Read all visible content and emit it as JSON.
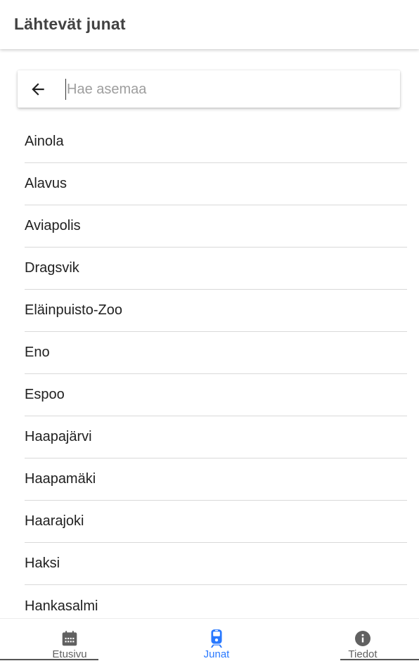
{
  "header": {
    "title": "Lähtevät junat"
  },
  "search": {
    "placeholder": "Hae asemaa",
    "value": ""
  },
  "stations": [
    "Ainola",
    "Alavus",
    "Aviapolis",
    "Dragsvik",
    "Eläinpuisto-Zoo",
    "Eno",
    "Espoo",
    "Haapajärvi",
    "Haapamäki",
    "Haarajoki",
    "Haksi",
    "Hankasalmi"
  ],
  "bottom_nav": {
    "items": [
      {
        "label": "Etusivu",
        "icon": "calendar-icon",
        "active": false
      },
      {
        "label": "Junat",
        "icon": "train-icon",
        "active": true
      },
      {
        "label": "Tiedot",
        "icon": "info-icon",
        "active": false
      }
    ]
  },
  "colors": {
    "accent": "#2979ff",
    "icon": "#616161",
    "divider": "#d9d9d9",
    "title": "#424242"
  }
}
